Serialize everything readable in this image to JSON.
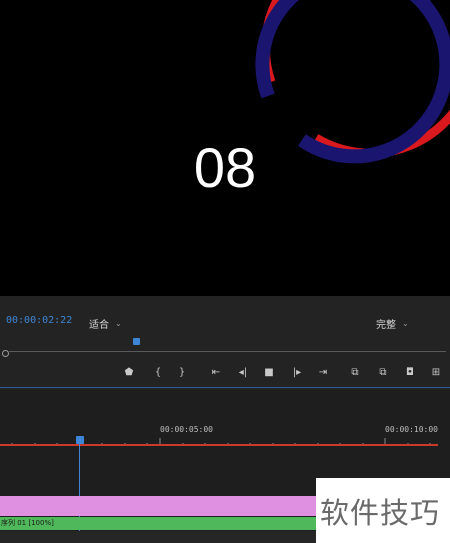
{
  "preview": {
    "countdown": "08",
    "ring_outer_color": "#d9191e",
    "ring_inner_color": "#1a1670",
    "background": "#000000"
  },
  "program_bar": {
    "timecode": "00:00:02:22",
    "zoom_select": "适合",
    "quality_select": "完整"
  },
  "timeline": {
    "time_5s": "00:00:05:00",
    "time_10s": "00:00:10:00",
    "clip_label": "序列 01 [100%]"
  },
  "watermark": "软件技巧",
  "colors": {
    "accent_blue": "#3d86d6",
    "timeline_red": "#c83a2a",
    "clip_pink": "#e090e0",
    "clip_green": "#4fb85a"
  }
}
